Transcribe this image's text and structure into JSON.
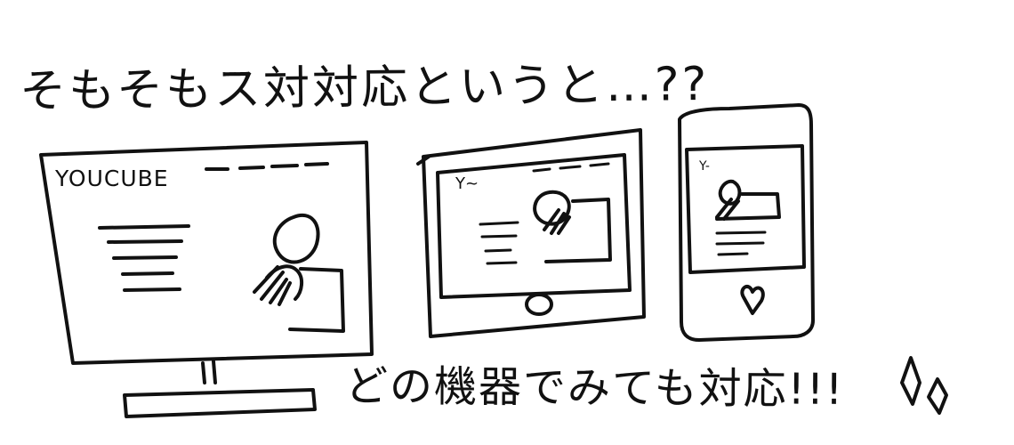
{
  "heading": {
    "text": "そもそもス対対応というと…??"
  },
  "caption": {
    "text": "どの機器でみても対応!!!"
  },
  "devices": {
    "monitor": {
      "logo": "YOUCUBE",
      "icon": "person-icon"
    },
    "tablet": {
      "logo": "Y~",
      "icon": "person-icon"
    },
    "phone": {
      "logo": "Y-",
      "icon": "person-icon"
    }
  },
  "decoration": {
    "icon": "sparkle-icon"
  }
}
